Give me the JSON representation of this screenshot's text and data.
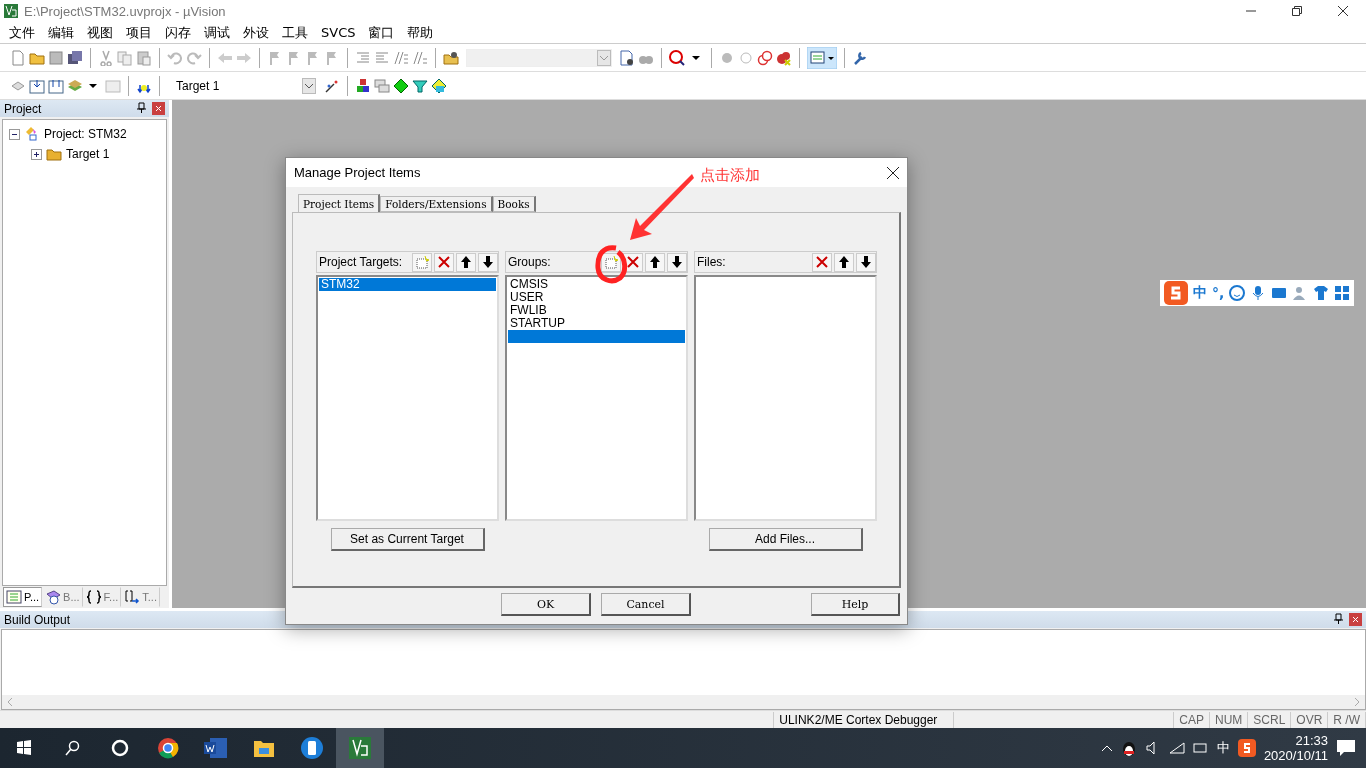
{
  "window": {
    "title": "E:\\Project\\STM32.uvprojx - µVision"
  },
  "menu": [
    "文件",
    "编辑",
    "视图",
    "项目",
    "闪存",
    "调试",
    "外设",
    "工具",
    "SVCS",
    "窗口",
    "帮助"
  ],
  "toolbar": {
    "target": "Target 1"
  },
  "project_panel": {
    "title": "Project",
    "tree": [
      {
        "label": "Project: STM32",
        "expanded": true,
        "children": [
          {
            "label": "Target 1",
            "expanded": false
          }
        ]
      }
    ],
    "tabs": [
      {
        "label": "P...",
        "selected": true
      },
      {
        "label": "B...",
        "selected": false
      },
      {
        "label": "F...",
        "selected": false
      },
      {
        "label": "T...",
        "selected": false
      }
    ]
  },
  "dialog": {
    "title": "Manage Project Items",
    "tabs": [
      {
        "label": "Project Items",
        "selected": true
      },
      {
        "label": "Folders/Extensions",
        "selected": false
      },
      {
        "label": "Books",
        "selected": false
      }
    ],
    "lists": [
      {
        "label": "Project Targets:",
        "can_add": true,
        "new_entry": false,
        "button": "Set as Current Target",
        "items": [
          {
            "label": "STM32",
            "selected": true
          }
        ]
      },
      {
        "label": "Groups:",
        "can_add": true,
        "new_entry": true,
        "items": [
          {
            "label": "CMSIS",
            "selected": false
          },
          {
            "label": "USER",
            "selected": false
          },
          {
            "label": "FWLIB",
            "selected": false
          },
          {
            "label": "STARTUP",
            "selected": false
          }
        ]
      },
      {
        "label": "Files:",
        "can_add": false,
        "new_entry": false,
        "button": "Add Files..."
      }
    ],
    "buttons": [
      "OK",
      "Cancel",
      "Help"
    ]
  },
  "annotation": {
    "text": "点击添加"
  },
  "ime_bar": {
    "mode": "中",
    "punctuation": "°,"
  },
  "build_output": {
    "title": "Build Output"
  },
  "status_bar": {
    "debugger": "ULINK2/ME Cortex Debugger",
    "indicators": [
      "CAP",
      "NUM",
      "SCRL",
      "OVR",
      "R /W"
    ]
  },
  "taskbar": {
    "ime": "中",
    "time": "21:33",
    "date": "2020/10/11"
  }
}
